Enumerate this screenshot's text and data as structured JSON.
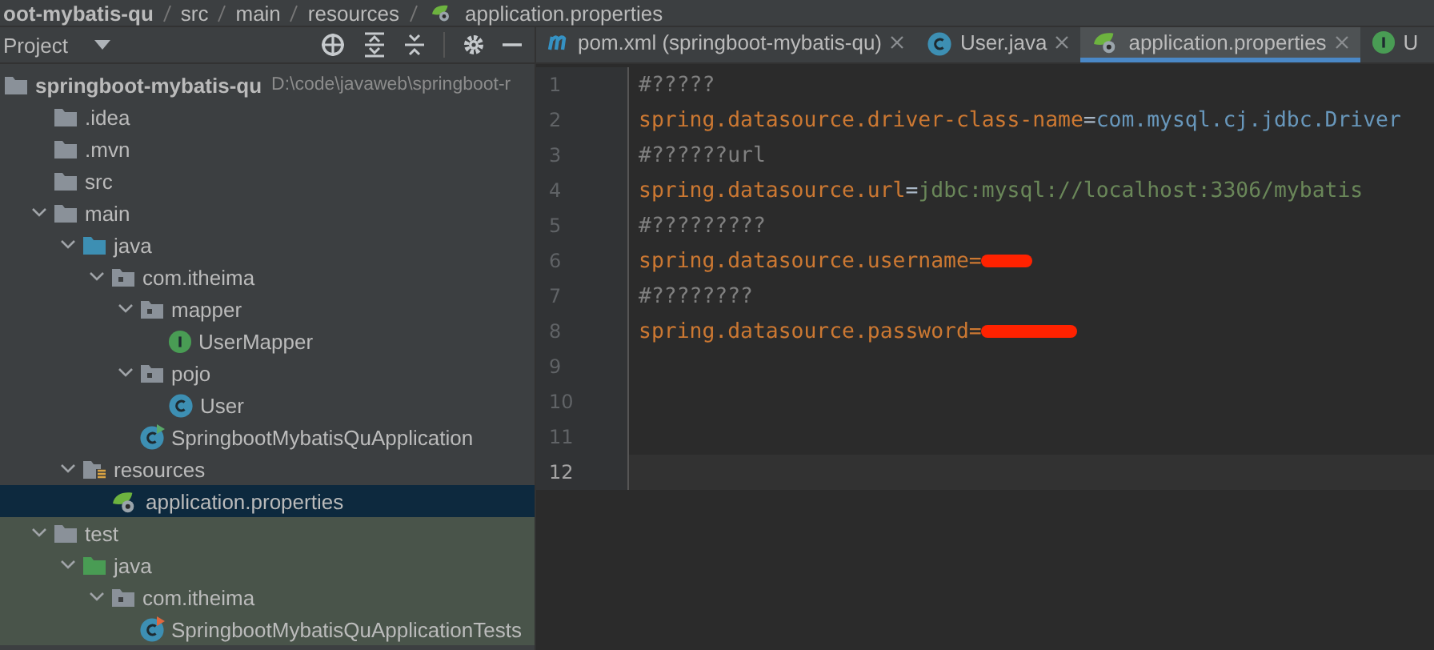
{
  "breadcrumb": [
    "oot-mybatis-qu",
    "src",
    "main",
    "resources",
    "application.properties"
  ],
  "project_panel": {
    "title": "Project"
  },
  "tree": [
    {
      "label": "springboot-mybatis-qu",
      "path": "D:\\code\\javaweb\\springboot-r",
      "kind": "module",
      "selected": false,
      "children": [
        {
          "label": ".idea",
          "kind": "folder",
          "selected": false
        },
        {
          "label": ".mvn",
          "kind": "folder",
          "selected": false
        },
        {
          "label": "src",
          "kind": "folder",
          "selected": false
        },
        {
          "label": "main",
          "kind": "folder",
          "expanded": true,
          "selected": false,
          "children": [
            {
              "label": "java",
              "kind": "source",
              "expanded": true,
              "selected": false,
              "children": [
                {
                  "label": "com.itheima",
                  "kind": "package",
                  "expanded": true,
                  "selected": false,
                  "children": [
                    {
                      "label": "mapper",
                      "kind": "package",
                      "expanded": true,
                      "selected": false,
                      "children": [
                        {
                          "label": "UserMapper",
                          "kind": "interface",
                          "selected": false
                        }
                      ]
                    },
                    {
                      "label": "pojo",
                      "kind": "package",
                      "expanded": true,
                      "selected": false,
                      "children": [
                        {
                          "label": "User",
                          "kind": "class",
                          "selected": false
                        }
                      ]
                    },
                    {
                      "label": "SpringbootMybatisQuApplication",
                      "kind": "app",
                      "selected": false
                    }
                  ]
                }
              ]
            },
            {
              "label": "resources",
              "kind": "resources",
              "expanded": true,
              "selected": false,
              "children": [
                {
                  "label": "application.properties",
                  "kind": "properties",
                  "selected": true
                }
              ]
            }
          ]
        },
        {
          "label": "test",
          "kind": "folder",
          "expanded": true,
          "selected": false,
          "test_scope": true,
          "children": [
            {
              "label": "java",
              "kind": "test-source",
              "expanded": true,
              "selected": false,
              "children": [
                {
                  "label": "com.itheima",
                  "kind": "package",
                  "expanded": true,
                  "selected": false,
                  "children": [
                    {
                      "label": "SpringbootMybatisQuApplicationTests",
                      "kind": "test-class",
                      "selected": false
                    }
                  ]
                }
              ]
            }
          ]
        }
      ]
    }
  ],
  "tabs": [
    {
      "label": "pom.xml (springboot-mybatis-qu)",
      "kind": "maven",
      "selected": false
    },
    {
      "label": "User.java",
      "kind": "class",
      "selected": false
    },
    {
      "label": "application.properties",
      "kind": "properties",
      "selected": true
    },
    {
      "label": "U",
      "kind": "interface",
      "selected": false
    }
  ],
  "lines": [
    {
      "number": "1",
      "current": false,
      "tokens": [
        {
          "kind": "comment",
          "text": "#?????"
        }
      ]
    },
    {
      "number": "2",
      "current": false,
      "tokens": [
        {
          "kind": "key",
          "text": "spring.datasource.driver-class-name"
        },
        {
          "kind": "eq",
          "text": "="
        },
        {
          "kind": "value",
          "text": "com.mysql.cj.jdbc.Driver"
        }
      ]
    },
    {
      "number": "3",
      "current": false,
      "tokens": [
        {
          "kind": "comment",
          "text": "#??????url"
        }
      ]
    },
    {
      "number": "4",
      "current": false,
      "tokens": [
        {
          "kind": "key",
          "text": "spring.datasource.url"
        },
        {
          "kind": "eq",
          "text": "="
        },
        {
          "kind": "string",
          "text": "jdbc:mysql://localhost:3306/mybatis"
        }
      ]
    },
    {
      "number": "5",
      "current": false,
      "tokens": [
        {
          "kind": "comment",
          "text": "#?????????"
        }
      ]
    },
    {
      "number": "6",
      "current": false,
      "tokens": [
        {
          "kind": "key",
          "text": "spring.datasource.username="
        },
        {
          "kind": "redacted"
        }
      ]
    },
    {
      "number": "7",
      "current": false,
      "tokens": [
        {
          "kind": "comment",
          "text": "#????????"
        }
      ]
    },
    {
      "number": "8",
      "current": false,
      "tokens": [
        {
          "kind": "key",
          "text": "spring.datasource.password="
        },
        {
          "kind": "redacted-long"
        }
      ]
    },
    {
      "number": "9",
      "current": false
    },
    {
      "number": "10",
      "current": false
    },
    {
      "number": "11",
      "current": false
    },
    {
      "number": "12",
      "current": true
    }
  ]
}
